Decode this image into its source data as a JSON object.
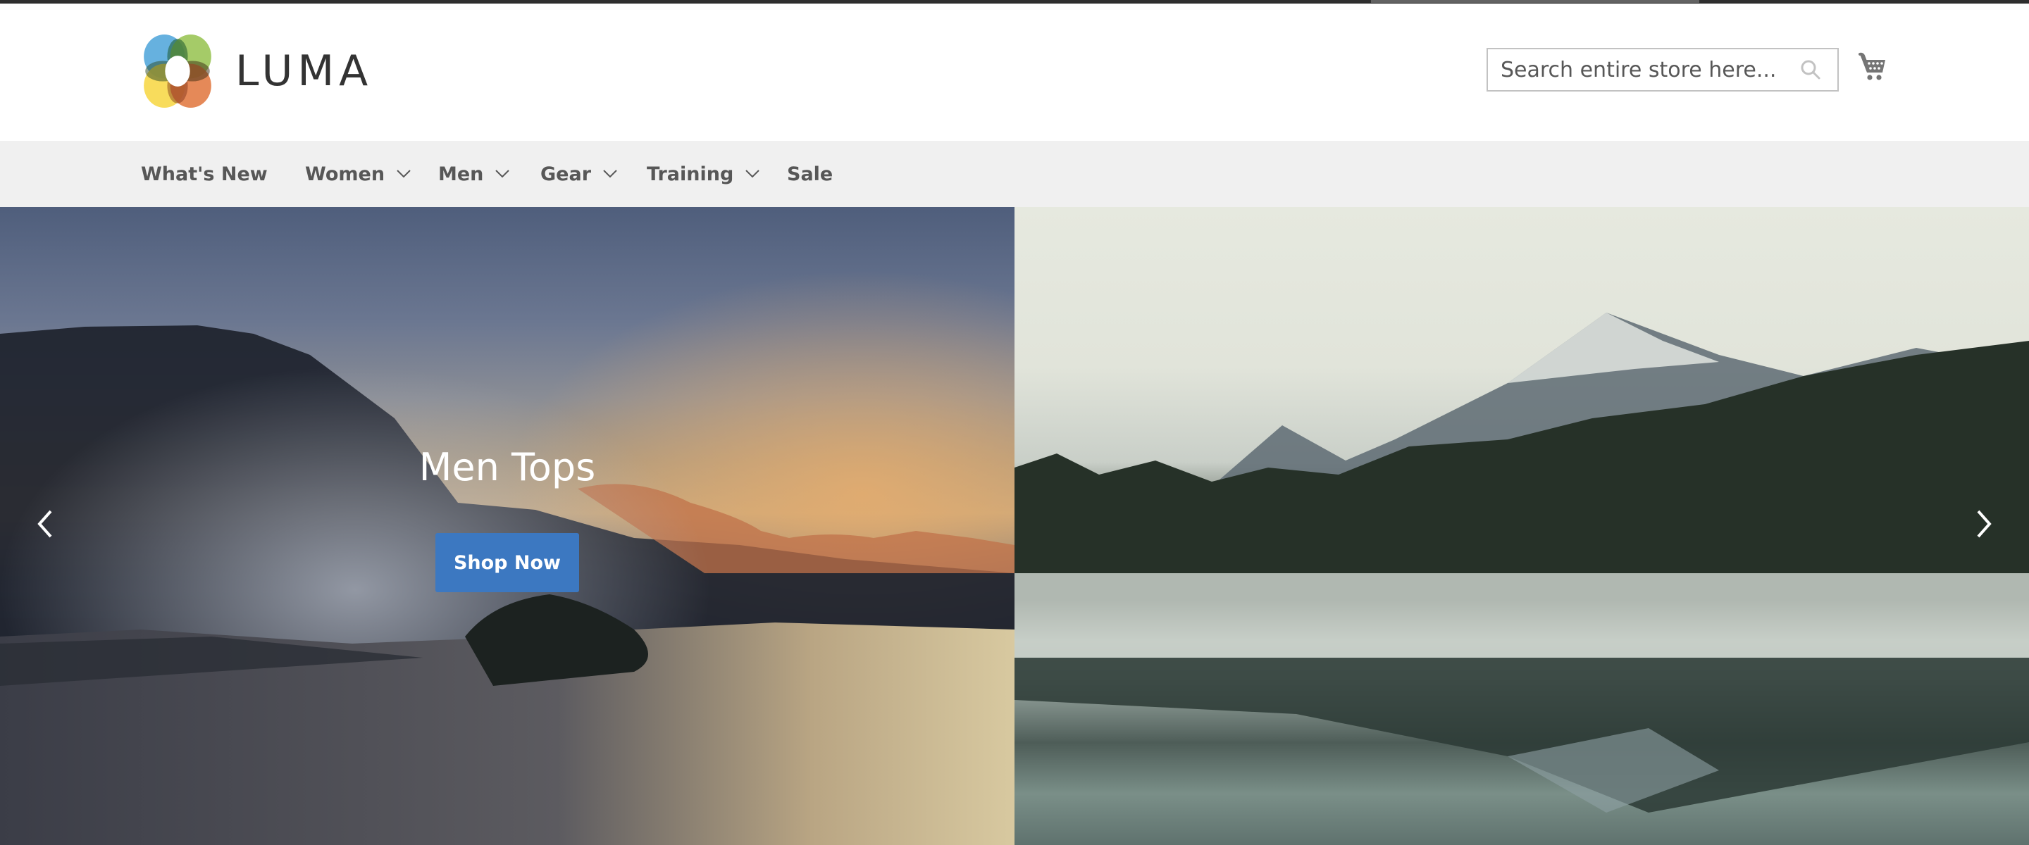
{
  "header": {
    "logo_text": "LUMA",
    "search": {
      "placeholder": "Search entire store here...",
      "value": ""
    },
    "icons": {
      "search": "search-icon",
      "cart": "cart-icon"
    }
  },
  "nav": {
    "items": [
      {
        "label": "What's New",
        "has_dropdown": false
      },
      {
        "label": "Women",
        "has_dropdown": true
      },
      {
        "label": "Men",
        "has_dropdown": true
      },
      {
        "label": "Gear",
        "has_dropdown": true
      },
      {
        "label": "Training",
        "has_dropdown": true
      },
      {
        "label": "Sale",
        "has_dropdown": false
      }
    ]
  },
  "hero": {
    "title": "Men Tops",
    "button_label": "Shop Now",
    "prev_icon": "chevron-left-icon",
    "next_icon": "chevron-right-icon"
  },
  "colors": {
    "button": "#3c78c1",
    "nav_bg": "#f0f0f0",
    "nav_text": "#575757",
    "logo_text": "#333333"
  }
}
